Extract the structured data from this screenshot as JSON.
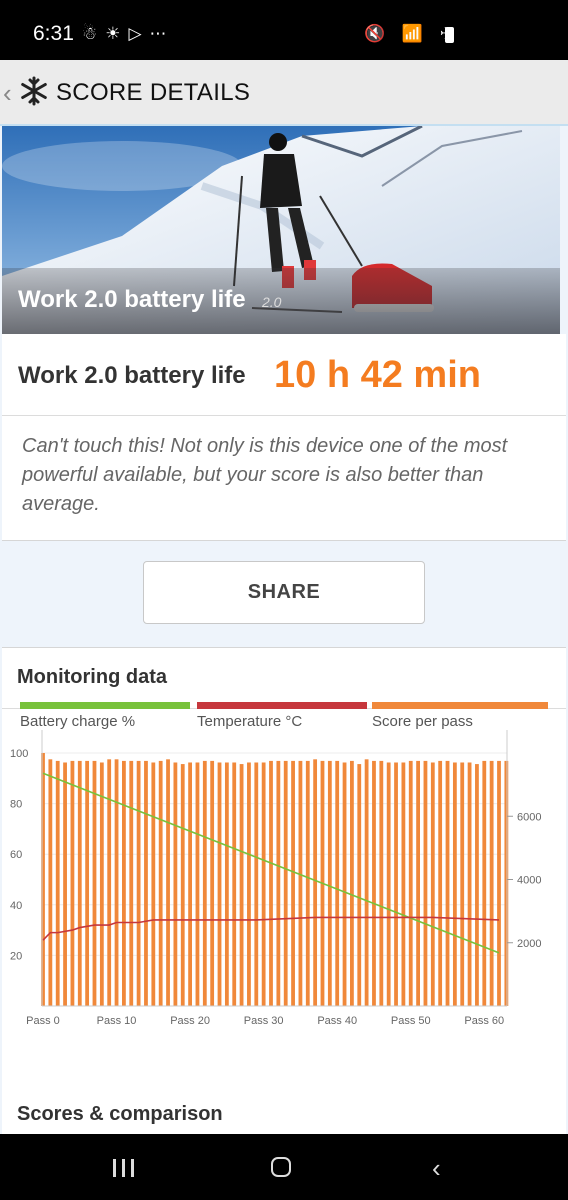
{
  "status_bar": {
    "time": "6:31",
    "left_icons": [
      "notification-icon",
      "weather-icon",
      "play-store-icon",
      "more-icon"
    ],
    "left_symbols": "☃☀▷⋯",
    "right_symbols": "🔇 📶 ✈",
    "right_icons": [
      "mute-icon",
      "wifi-icon",
      "airplane-icon",
      "battery-icon"
    ]
  },
  "app_bar": {
    "title": "SCORE DETAILS",
    "back_symbol": "‹",
    "logo_icon": "snowflake-logo-icon"
  },
  "hero": {
    "title": "Work 2.0 battery life",
    "version": "2.0"
  },
  "score": {
    "label": "Work 2.0 battery life",
    "value": "10 h 42 min",
    "value_color": "#f47c20",
    "description": "Can't touch this! Not only is this device one of the most powerful available, but your score is also better than average."
  },
  "share_button": {
    "label": "SHARE"
  },
  "monitoring": {
    "title": "Monitoring data",
    "legend": [
      {
        "label": "Battery charge %",
        "color": "#78c23b"
      },
      {
        "label": "Temperature °C",
        "color": "#c6373c"
      },
      {
        "label": "Score per pass",
        "color": "#f0883a"
      }
    ]
  },
  "scores_comparison": {
    "title": "Scores & comparison"
  },
  "chart_data": {
    "type": "bar",
    "x_ticks": [
      "Pass 0",
      "Pass 10",
      "Pass 20",
      "Pass 30",
      "Pass 40",
      "Pass 50",
      "Pass 60"
    ],
    "y_left_ticks": [
      "100",
      "80",
      "60",
      "40",
      "20"
    ],
    "y_right_ticks": [
      "6000",
      "4000",
      "2000"
    ],
    "ylim_left": [
      0,
      100
    ],
    "ylim_right": [
      0,
      8000
    ],
    "grid": true,
    "legend_position": "bottom",
    "series": [
      {
        "name": "Score per pass",
        "axis": "right",
        "type": "bar",
        "x": [
          0,
          1,
          2,
          3,
          4,
          5,
          6,
          7,
          8,
          9,
          10,
          11,
          12,
          13,
          14,
          15,
          16,
          17,
          18,
          19,
          20,
          21,
          22,
          23,
          24,
          25,
          26,
          27,
          28,
          29,
          30,
          31,
          32,
          33,
          34,
          35,
          36,
          37,
          38,
          39,
          40,
          41,
          42,
          43,
          44,
          45,
          46,
          47,
          48,
          49,
          50,
          51,
          52,
          53,
          54,
          55,
          56,
          57,
          58,
          59,
          60,
          61,
          62,
          63
        ],
        "values": [
          8000,
          7800,
          7750,
          7700,
          7750,
          7750,
          7750,
          7750,
          7700,
          7800,
          7800,
          7750,
          7750,
          7750,
          7750,
          7700,
          7750,
          7800,
          7700,
          7650,
          7700,
          7700,
          7750,
          7750,
          7700,
          7700,
          7700,
          7650,
          7700,
          7700,
          7700,
          7750,
          7750,
          7750,
          7750,
          7750,
          7750,
          7800,
          7750,
          7750,
          7750,
          7700,
          7750,
          7650,
          7800,
          7750,
          7750,
          7700,
          7700,
          7700,
          7750,
          7750,
          7750,
          7700,
          7750,
          7750,
          7700,
          7700,
          7700,
          7650,
          7750,
          7750,
          7750,
          7750
        ]
      },
      {
        "name": "Battery charge %",
        "axis": "left",
        "type": "line",
        "x": [
          0,
          62
        ],
        "values": [
          92,
          21
        ]
      },
      {
        "name": "Temperature °C",
        "axis": "left",
        "type": "line",
        "x": [
          0,
          1,
          2,
          4,
          5,
          7,
          9,
          10,
          13,
          15,
          18,
          23,
          29,
          37,
          45,
          53,
          62
        ],
        "values": [
          26,
          29,
          29,
          30,
          31,
          32,
          32,
          33,
          33,
          34,
          34,
          34,
          34,
          35,
          35,
          35,
          34
        ]
      }
    ]
  }
}
